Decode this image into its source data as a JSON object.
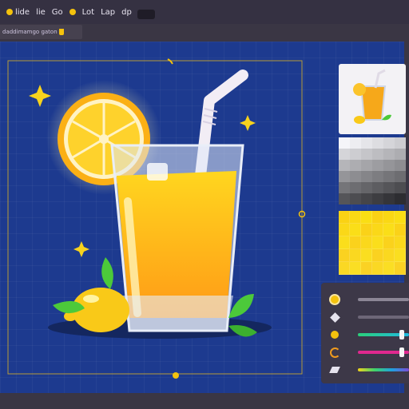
{
  "menubar": {
    "items": [
      {
        "label": "lide"
      },
      {
        "label": "lie"
      },
      {
        "label": "Go"
      },
      {
        "label": "Lot"
      },
      {
        "label": "Lap"
      },
      {
        "label": "dp"
      }
    ]
  },
  "file_tab": {
    "label": "daddimamgo gaton"
  },
  "colors": {
    "canvas": "#1d3a8f",
    "accent": "#f4c20d",
    "panel": "#3d3848"
  },
  "tool_panel": {
    "rows": [
      {
        "icon": "sun-icon"
      },
      {
        "icon": "cube-icon"
      },
      {
        "icon": "palette-icon"
      },
      {
        "icon": "refresh-icon"
      },
      {
        "icon": "eraser-icon"
      }
    ]
  }
}
